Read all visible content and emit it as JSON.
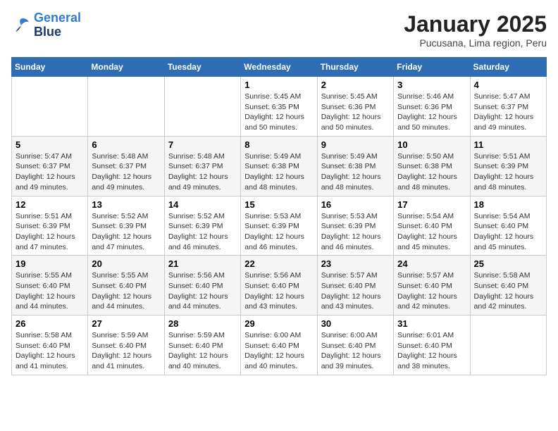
{
  "header": {
    "logo_line1": "General",
    "logo_line2": "Blue",
    "month_title": "January 2025",
    "location": "Pucusana, Lima region, Peru"
  },
  "days_of_week": [
    "Sunday",
    "Monday",
    "Tuesday",
    "Wednesday",
    "Thursday",
    "Friday",
    "Saturday"
  ],
  "weeks": [
    [
      {
        "day": "",
        "info": ""
      },
      {
        "day": "",
        "info": ""
      },
      {
        "day": "",
        "info": ""
      },
      {
        "day": "1",
        "info": "Sunrise: 5:45 AM\nSunset: 6:35 PM\nDaylight: 12 hours\nand 50 minutes."
      },
      {
        "day": "2",
        "info": "Sunrise: 5:45 AM\nSunset: 6:36 PM\nDaylight: 12 hours\nand 50 minutes."
      },
      {
        "day": "3",
        "info": "Sunrise: 5:46 AM\nSunset: 6:36 PM\nDaylight: 12 hours\nand 50 minutes."
      },
      {
        "day": "4",
        "info": "Sunrise: 5:47 AM\nSunset: 6:37 PM\nDaylight: 12 hours\nand 49 minutes."
      }
    ],
    [
      {
        "day": "5",
        "info": "Sunrise: 5:47 AM\nSunset: 6:37 PM\nDaylight: 12 hours\nand 49 minutes."
      },
      {
        "day": "6",
        "info": "Sunrise: 5:48 AM\nSunset: 6:37 PM\nDaylight: 12 hours\nand 49 minutes."
      },
      {
        "day": "7",
        "info": "Sunrise: 5:48 AM\nSunset: 6:37 PM\nDaylight: 12 hours\nand 49 minutes."
      },
      {
        "day": "8",
        "info": "Sunrise: 5:49 AM\nSunset: 6:38 PM\nDaylight: 12 hours\nand 48 minutes."
      },
      {
        "day": "9",
        "info": "Sunrise: 5:49 AM\nSunset: 6:38 PM\nDaylight: 12 hours\nand 48 minutes."
      },
      {
        "day": "10",
        "info": "Sunrise: 5:50 AM\nSunset: 6:38 PM\nDaylight: 12 hours\nand 48 minutes."
      },
      {
        "day": "11",
        "info": "Sunrise: 5:51 AM\nSunset: 6:39 PM\nDaylight: 12 hours\nand 48 minutes."
      }
    ],
    [
      {
        "day": "12",
        "info": "Sunrise: 5:51 AM\nSunset: 6:39 PM\nDaylight: 12 hours\nand 47 minutes."
      },
      {
        "day": "13",
        "info": "Sunrise: 5:52 AM\nSunset: 6:39 PM\nDaylight: 12 hours\nand 47 minutes."
      },
      {
        "day": "14",
        "info": "Sunrise: 5:52 AM\nSunset: 6:39 PM\nDaylight: 12 hours\nand 46 minutes."
      },
      {
        "day": "15",
        "info": "Sunrise: 5:53 AM\nSunset: 6:39 PM\nDaylight: 12 hours\nand 46 minutes."
      },
      {
        "day": "16",
        "info": "Sunrise: 5:53 AM\nSunset: 6:39 PM\nDaylight: 12 hours\nand 46 minutes."
      },
      {
        "day": "17",
        "info": "Sunrise: 5:54 AM\nSunset: 6:40 PM\nDaylight: 12 hours\nand 45 minutes."
      },
      {
        "day": "18",
        "info": "Sunrise: 5:54 AM\nSunset: 6:40 PM\nDaylight: 12 hours\nand 45 minutes."
      }
    ],
    [
      {
        "day": "19",
        "info": "Sunrise: 5:55 AM\nSunset: 6:40 PM\nDaylight: 12 hours\nand 44 minutes."
      },
      {
        "day": "20",
        "info": "Sunrise: 5:55 AM\nSunset: 6:40 PM\nDaylight: 12 hours\nand 44 minutes."
      },
      {
        "day": "21",
        "info": "Sunrise: 5:56 AM\nSunset: 6:40 PM\nDaylight: 12 hours\nand 44 minutes."
      },
      {
        "day": "22",
        "info": "Sunrise: 5:56 AM\nSunset: 6:40 PM\nDaylight: 12 hours\nand 43 minutes."
      },
      {
        "day": "23",
        "info": "Sunrise: 5:57 AM\nSunset: 6:40 PM\nDaylight: 12 hours\nand 43 minutes."
      },
      {
        "day": "24",
        "info": "Sunrise: 5:57 AM\nSunset: 6:40 PM\nDaylight: 12 hours\nand 42 minutes."
      },
      {
        "day": "25",
        "info": "Sunrise: 5:58 AM\nSunset: 6:40 PM\nDaylight: 12 hours\nand 42 minutes."
      }
    ],
    [
      {
        "day": "26",
        "info": "Sunrise: 5:58 AM\nSunset: 6:40 PM\nDaylight: 12 hours\nand 41 minutes."
      },
      {
        "day": "27",
        "info": "Sunrise: 5:59 AM\nSunset: 6:40 PM\nDaylight: 12 hours\nand 41 minutes."
      },
      {
        "day": "28",
        "info": "Sunrise: 5:59 AM\nSunset: 6:40 PM\nDaylight: 12 hours\nand 40 minutes."
      },
      {
        "day": "29",
        "info": "Sunrise: 6:00 AM\nSunset: 6:40 PM\nDaylight: 12 hours\nand 40 minutes."
      },
      {
        "day": "30",
        "info": "Sunrise: 6:00 AM\nSunset: 6:40 PM\nDaylight: 12 hours\nand 39 minutes."
      },
      {
        "day": "31",
        "info": "Sunrise: 6:01 AM\nSunset: 6:40 PM\nDaylight: 12 hours\nand 38 minutes."
      },
      {
        "day": "",
        "info": ""
      }
    ]
  ]
}
